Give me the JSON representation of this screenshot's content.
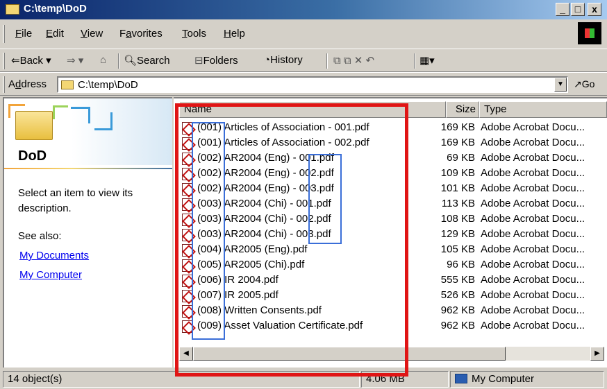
{
  "window": {
    "title": "C:\\temp\\DoD",
    "controls": {
      "minimize": "_",
      "maximize": "□",
      "close": "x"
    }
  },
  "menu": [
    {
      "label": "File",
      "key": "F",
      "rest": "ile"
    },
    {
      "label": "Edit",
      "key": "E",
      "rest": "dit"
    },
    {
      "label": "View",
      "key": "V",
      "rest": "iew"
    },
    {
      "label": "Favorites",
      "pre": "F",
      "key": "a",
      "rest": "vorites"
    },
    {
      "label": "Tools",
      "key": "T",
      "rest": "ools"
    },
    {
      "label": "Help",
      "key": "H",
      "rest": "elp"
    }
  ],
  "toolbar": {
    "back": "⇐Back ▾",
    "forward": "⇒ ▾",
    "up_icon": "⌂",
    "search": "Search",
    "folders": "Folders",
    "history": "History",
    "icons": "⧉  ⧉  ✕  ↶",
    "views": "▦▾"
  },
  "address": {
    "label_pre": "A",
    "label_key": "d",
    "label_rest": "dress",
    "value": "C:\\temp\\DoD",
    "dropdown": "▼",
    "go": "Go",
    "go_icon": "↗"
  },
  "left_panel": {
    "title": "DoD",
    "description": "Select an item to view its description.",
    "see_also": "See also:",
    "links": [
      "My Documents",
      "My Computer"
    ]
  },
  "list": {
    "columns": {
      "name": "Name",
      "size": "Size",
      "type": "Type"
    },
    "files": [
      {
        "name": "(001) Articles of Association - 001.pdf",
        "size": "169 KB",
        "type": "Adobe Acrobat Docu..."
      },
      {
        "name": "(001) Articles of Association - 002.pdf",
        "size": "169 KB",
        "type": "Adobe Acrobat Docu..."
      },
      {
        "name": "(002) AR2004 (Eng) - 001.pdf",
        "size": "69 KB",
        "type": "Adobe Acrobat Docu..."
      },
      {
        "name": "(002) AR2004 (Eng) - 002.pdf",
        "size": "109 KB",
        "type": "Adobe Acrobat Docu..."
      },
      {
        "name": "(002) AR2004 (Eng) - 003.pdf",
        "size": "101 KB",
        "type": "Adobe Acrobat Docu..."
      },
      {
        "name": "(003) AR2004 (Chi) - 001.pdf",
        "size": "113 KB",
        "type": "Adobe Acrobat Docu..."
      },
      {
        "name": "(003) AR2004 (Chi) - 002.pdf",
        "size": "108 KB",
        "type": "Adobe Acrobat Docu..."
      },
      {
        "name": "(003) AR2004 (Chi) - 003.pdf",
        "size": "129 KB",
        "type": "Adobe Acrobat Docu..."
      },
      {
        "name": "(004) AR2005 (Eng).pdf",
        "size": "105 KB",
        "type": "Adobe Acrobat Docu..."
      },
      {
        "name": "(005) AR2005 (Chi).pdf",
        "size": "96 KB",
        "type": "Adobe Acrobat Docu..."
      },
      {
        "name": "(006) IR 2004.pdf",
        "size": "555 KB",
        "type": "Adobe Acrobat Docu..."
      },
      {
        "name": "(007) IR 2005.pdf",
        "size": "526 KB",
        "type": "Adobe Acrobat Docu..."
      },
      {
        "name": "(008) Written Consents.pdf",
        "size": "962 KB",
        "type": "Adobe Acrobat Docu..."
      },
      {
        "name": "(009) Asset Valuation Certificate.pdf",
        "size": "962 KB",
        "type": "Adobe Acrobat Docu..."
      }
    ]
  },
  "status": {
    "objects": "14 object(s)",
    "size": "4.06 MB",
    "zone": "My Computer"
  },
  "colors": {
    "title_start": "#0a246a",
    "highlight_red": "#e01515",
    "highlight_blue": "#3a6ed8",
    "link": "#0000ee"
  }
}
